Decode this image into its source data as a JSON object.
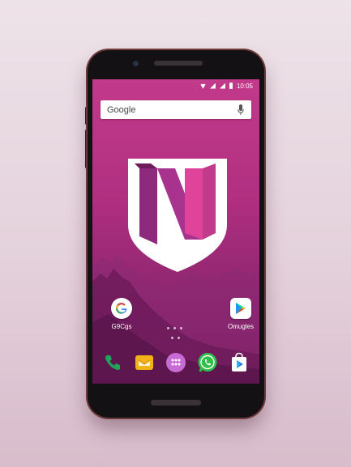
{
  "status_bar": {
    "time": "10:05",
    "icons": [
      "wifi-icon",
      "signal-icon",
      "signal-icon",
      "battery-icon"
    ]
  },
  "search": {
    "label": "Google",
    "icons": [
      "mic-icon"
    ]
  },
  "wallpaper": {
    "logo": "N",
    "colors": {
      "screen_top": "#c23a8a",
      "screen_bottom": "#6e1b5a",
      "shield": "#ffffff",
      "logo_purple": "#8e2a7d",
      "logo_pink": "#e0449a"
    }
  },
  "home_apps": [
    {
      "label": "G9Cgs",
      "icon": "google-g-icon"
    },
    {
      "label": "Omugles",
      "icon": "play-store-icon"
    }
  ],
  "dock": [
    {
      "icon": "phone-icon",
      "color": "#1fa45a"
    },
    {
      "icon": "email-icon",
      "color": "#f2b318"
    },
    {
      "icon": "app-drawer-icon",
      "color": "#c96bd5"
    },
    {
      "icon": "whatsapp-icon",
      "color": "#2fbf4b"
    },
    {
      "icon": "play-store-bag-icon",
      "color": "#2a7de1"
    }
  ],
  "page_indicator": {
    "count": 3
  }
}
